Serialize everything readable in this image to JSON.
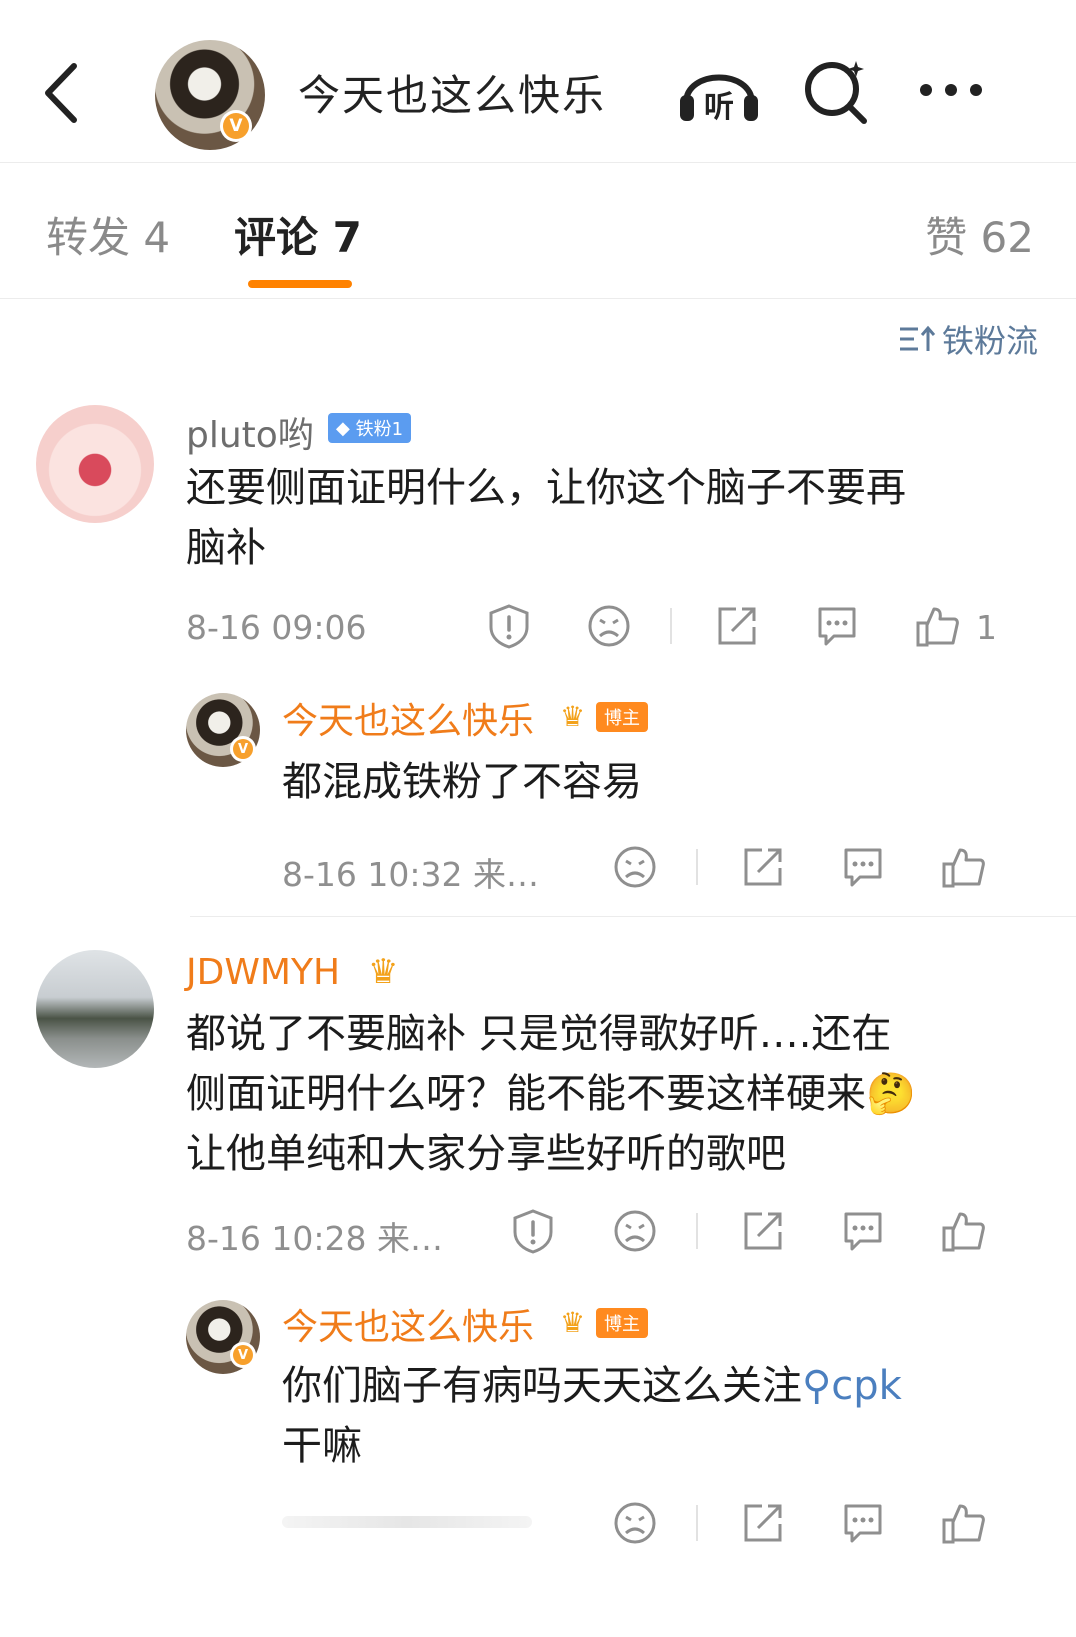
{
  "header": {
    "title": "今天也这么快乐",
    "listen_label": "听"
  },
  "tabs": [
    {
      "label": "转发 4"
    },
    {
      "label": "评论 7"
    },
    {
      "label": "赞 62"
    }
  ],
  "sort_label": "铁粉流",
  "comments": [
    {
      "user": "pluto哟",
      "badge": "铁粉1",
      "text_line1": "还要侧面证明什么，让你这个脑子不要再",
      "text_line2": "脑补",
      "time": "8-16 09:06",
      "likes": "1",
      "reply": {
        "user": "今天也这么快乐",
        "badge": "博主",
        "text": "都混成铁粉了不容易",
        "time": "8-16 10:32 来…"
      }
    },
    {
      "user": "JDWMYH",
      "text_line1": "都说了不要脑补 只是觉得歌好听….还在",
      "text_line2": "侧面证明什么呀？能不能不要这样硬来",
      "emoji": "🤔",
      "text_line3": "让他单纯和大家分享些好听的歌吧",
      "time": "8-16 10:28 来…",
      "reply": {
        "user": "今天也这么快乐",
        "badge": "博主",
        "text_prefix": "你们脑子有病吗天天这么关注",
        "link_text": "cpk",
        "text_line2": "干嘛"
      }
    }
  ],
  "colors": {
    "accent": "#ff8200",
    "username_orange": "#f07c1a",
    "link_blue": "#4b7fbf",
    "badge_blue": "#5b9cf0",
    "badge_orange": "#ff8a1f"
  }
}
